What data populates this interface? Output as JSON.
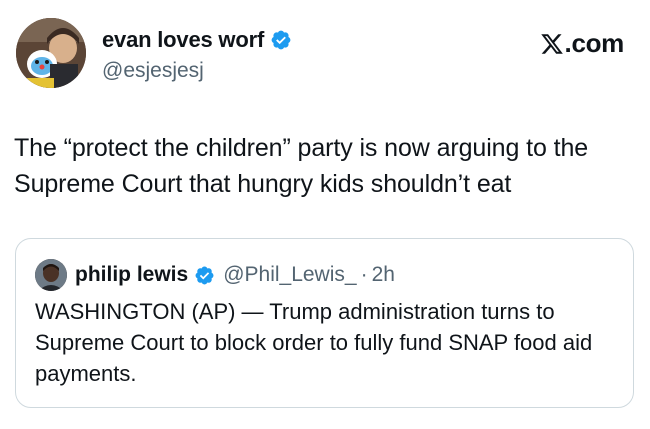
{
  "tweet": {
    "author": {
      "display_name": "evan loves worf",
      "handle": "@esjesjesj",
      "verified": true,
      "avatar_icon": "profile-photo"
    },
    "brand": {
      "label": ".com",
      "icon": "x-logo"
    },
    "text": "The “protect the children” party is now arguing to the Supreme Court that hungry kids shouldn’t eat"
  },
  "quoted_tweet": {
    "author": {
      "display_name": "philip lewis",
      "handle": "@Phil_Lewis_",
      "verified": true,
      "avatar_icon": "profile-photo"
    },
    "separator": "·",
    "time": "2h",
    "text": "WASHINGTON (AP) — Trump administration turns to Supreme Court to block order to fully fund SNAP food aid payments."
  },
  "colors": {
    "text": "#0f1419",
    "secondary": "#536471",
    "verified": "#1d9bf0",
    "border": "#cfd9de"
  }
}
